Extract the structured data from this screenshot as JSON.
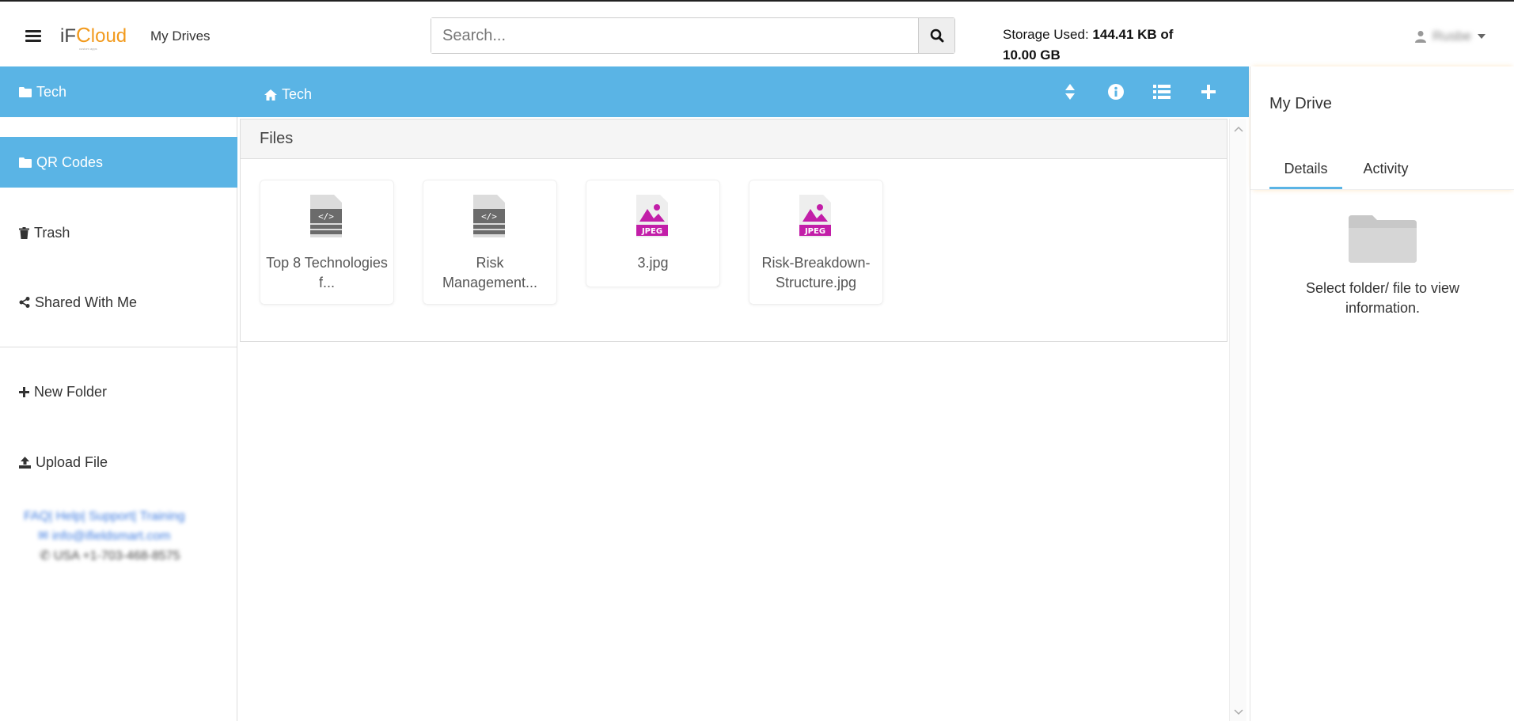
{
  "header": {
    "logo": {
      "if": "iF",
      "c": "C",
      "loud": "loud",
      "tagline": "custom apps"
    },
    "crumb": "My Drives",
    "search": {
      "placeholder": "Search...",
      "value": ""
    },
    "storage": {
      "label": "Storage Used:",
      "value": "144.41 KB of 10.00 GB"
    },
    "user": {
      "name": "Rusbe"
    }
  },
  "sidebar": {
    "items": [
      {
        "label": "Tech",
        "icon": "folder-icon",
        "active": true
      },
      {
        "label": "QR Codes",
        "icon": "folder-icon",
        "active": true
      },
      {
        "label": "Trash",
        "icon": "trash-icon",
        "active": false
      },
      {
        "label": "Shared With Me",
        "icon": "share-icon",
        "active": false
      },
      {
        "label": "New Folder",
        "icon": "plus-icon",
        "active": false
      },
      {
        "label": "Upload File",
        "icon": "upload-icon",
        "active": false
      }
    ],
    "footer": {
      "links": "FAQ| Help| Support| Training",
      "email": "info@ifieldsmart.com",
      "phone": "USA   +1-703-468-8575"
    }
  },
  "main": {
    "crumb": "Tech",
    "files_heading": "Files",
    "files": [
      {
        "name": "Top 8 Technologies f...",
        "type": "code"
      },
      {
        "name": "Risk Management...",
        "type": "code"
      },
      {
        "name": "3.jpg",
        "type": "jpeg"
      },
      {
        "name": "Risk-Breakdown-Structure.jpg",
        "type": "jpeg"
      }
    ],
    "tools": [
      "sort-icon",
      "info-icon",
      "list-view-icon",
      "add-icon"
    ]
  },
  "right_panel": {
    "title": "My Drive",
    "tabs": [
      "Details",
      "Activity"
    ],
    "info": "Select folder/ file to view information."
  },
  "colors": {
    "accent": "#5ab4e5",
    "brand": "#f29a1d",
    "jpeg": "#c21ea8"
  }
}
